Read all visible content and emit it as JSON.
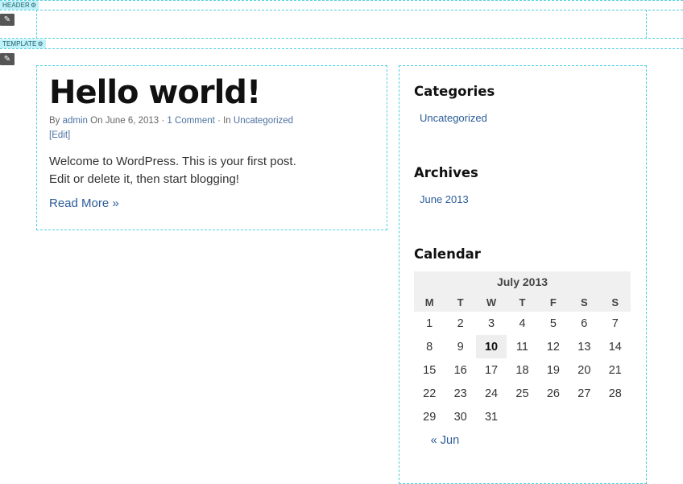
{
  "builder": {
    "header_tag": "HEADER",
    "template_tag": "TEMPLATE",
    "edit_icon_glyph": "✎"
  },
  "post": {
    "title": "Hello world!",
    "by_label": "By",
    "author": "admin",
    "on_label": "On June 6, 2013 ·",
    "comments": "1 Comment",
    "in_label": "· In",
    "category": "Uncategorized",
    "edit": "[Edit]",
    "body_line1": "Welcome to WordPress. This is your first post.",
    "body_line2": "Edit or delete it, then start blogging!",
    "read_more": "Read More »"
  },
  "sidebar": {
    "categories": {
      "title": "Categories",
      "items": [
        "Uncategorized"
      ]
    },
    "archives": {
      "title": "Archives",
      "items": [
        "June 2013"
      ]
    },
    "calendar": {
      "title": "Calendar",
      "caption": "July 2013",
      "days": [
        "M",
        "T",
        "W",
        "T",
        "F",
        "S",
        "S"
      ],
      "weeks": [
        [
          "1",
          "2",
          "3",
          "4",
          "5",
          "6",
          "7"
        ],
        [
          "8",
          "9",
          "10",
          "11",
          "12",
          "13",
          "14"
        ],
        [
          "15",
          "16",
          "17",
          "18",
          "19",
          "20",
          "21"
        ],
        [
          "22",
          "23",
          "24",
          "25",
          "26",
          "27",
          "28"
        ],
        [
          "29",
          "30",
          "31",
          "",
          "",
          "",
          ""
        ]
      ],
      "today": "10",
      "prev": "« Jun"
    }
  },
  "colors": {
    "guide": "#4fd0e0",
    "link": "#2b5c97",
    "tag_bg": "#bff1f8"
  }
}
